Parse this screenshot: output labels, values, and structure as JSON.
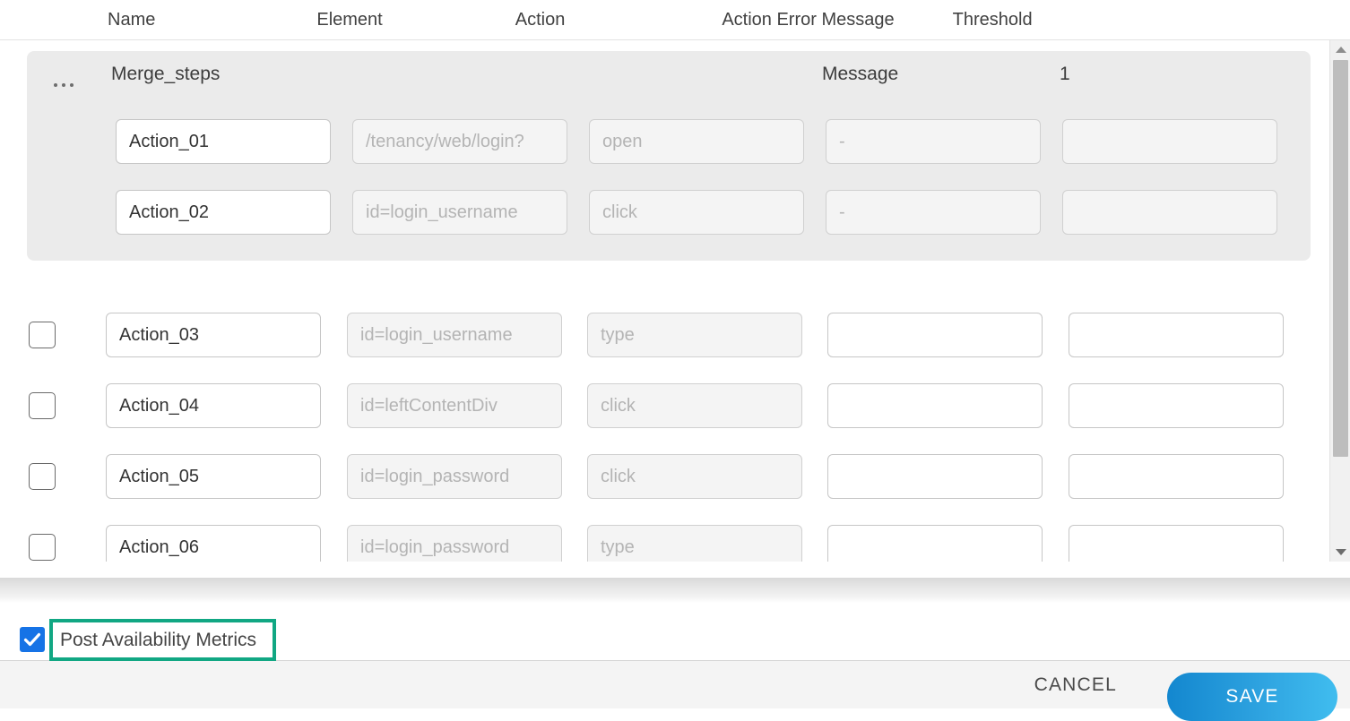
{
  "table": {
    "columns": [
      "Name",
      "Element",
      "Action",
      "Action Error Message",
      "Threshold"
    ],
    "merge_group": {
      "name": "Merge_steps",
      "error_message": "Message",
      "threshold": "1",
      "handle_icon": "drag-dots-icon",
      "rows": [
        {
          "name": "Action_01",
          "element_placeholder": "/tenancy/web/login?",
          "action_placeholder": "open",
          "error_placeholder": "-",
          "threshold_placeholder": ""
        },
        {
          "name": "Action_02",
          "element_placeholder": "id=login_username",
          "action_placeholder": "click",
          "error_placeholder": "-",
          "threshold_placeholder": ""
        }
      ]
    },
    "rows": [
      {
        "checked": false,
        "name": "Action_03",
        "element_placeholder": "id=login_username",
        "action_placeholder": "type",
        "error_placeholder": "",
        "threshold_placeholder": ""
      },
      {
        "checked": false,
        "name": "Action_04",
        "element_placeholder": "id=leftContentDiv",
        "action_placeholder": "click",
        "error_placeholder": "",
        "threshold_placeholder": ""
      },
      {
        "checked": false,
        "name": "Action_05",
        "element_placeholder": "id=login_password",
        "action_placeholder": "click",
        "error_placeholder": "",
        "threshold_placeholder": ""
      },
      {
        "checked": false,
        "name": "Action_06",
        "element_placeholder": "id=login_password",
        "action_placeholder": "type",
        "error_placeholder": "",
        "threshold_placeholder": ""
      }
    ]
  },
  "scrollbar": {
    "up_icon": "triangle-up-icon",
    "down_icon": "triangle-down-icon"
  },
  "post_availability": {
    "label": "Post Availability Metrics",
    "checked": true,
    "check_icon": "checkmark-icon",
    "highlight_color": "#11a783",
    "checkbox_color": "#1673e6"
  },
  "footer": {
    "cancel_label": "CANCEL",
    "save_label": "SAVE",
    "save_color": "#2ea3e0"
  }
}
